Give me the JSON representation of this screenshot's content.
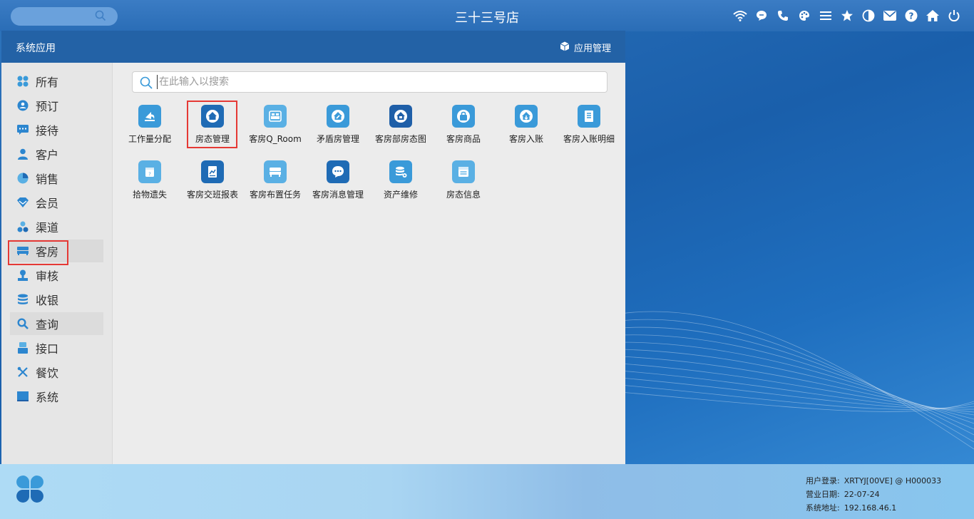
{
  "topbar": {
    "title": "三十三号店",
    "search_placeholder": "",
    "icons": [
      "wifi-icon",
      "chat-icon",
      "phone-icon",
      "palette-icon",
      "menu-icon",
      "star-icon",
      "theme-icon",
      "mail-icon",
      "help-icon",
      "home-icon",
      "power-icon"
    ]
  },
  "app": {
    "title": "系统应用",
    "manage_label": "应用管理",
    "search_placeholder": "在此输入以搜索",
    "sidebar": {
      "items": [
        {
          "label": "所有",
          "icon": "grid-icon"
        },
        {
          "label": "预订",
          "icon": "booking-icon"
        },
        {
          "label": "接待",
          "icon": "reception-icon"
        },
        {
          "label": "客户",
          "icon": "customer-icon"
        },
        {
          "label": "销售",
          "icon": "sales-icon"
        },
        {
          "label": "会员",
          "icon": "member-icon"
        },
        {
          "label": "渠道",
          "icon": "channel-icon"
        },
        {
          "label": "客房",
          "icon": "room-icon"
        },
        {
          "label": "审核",
          "icon": "audit-icon"
        },
        {
          "label": "收银",
          "icon": "cashier-icon"
        },
        {
          "label": "查询",
          "icon": "query-icon"
        },
        {
          "label": "接口",
          "icon": "interface-icon"
        },
        {
          "label": "餐饮",
          "icon": "dining-icon"
        },
        {
          "label": "系统",
          "icon": "system-icon"
        }
      ],
      "selected": "客房"
    },
    "tiles": [
      {
        "label": "工作量分配",
        "icon": "workload-icon",
        "color": "#3a9ad9"
      },
      {
        "label": "房态管理",
        "icon": "house-icon",
        "color": "#1f6bb5"
      },
      {
        "label": "客房Q_Room",
        "icon": "bed-icon",
        "color": "#5ab0e4"
      },
      {
        "label": "矛盾房管理",
        "icon": "conflict-room-icon",
        "color": "#3a9ad9"
      },
      {
        "label": "客房部房态图",
        "icon": "room-status-map-icon",
        "color": "#1f5fa8"
      },
      {
        "label": "客房商品",
        "icon": "bag-icon",
        "color": "#3a9ad9"
      },
      {
        "label": "客房入账",
        "icon": "room-posting-icon",
        "color": "#3a9ad9"
      },
      {
        "label": "客房入账明细",
        "icon": "posting-detail-icon",
        "color": "#3a9ad9"
      },
      {
        "label": "拾物遗失",
        "icon": "lost-found-icon",
        "color": "#5ab0e4"
      },
      {
        "label": "客房交班报表",
        "icon": "shift-report-icon",
        "color": "#1f6bb5"
      },
      {
        "label": "客房布置任务",
        "icon": "bed-task-icon",
        "color": "#5ab0e4"
      },
      {
        "label": "客房消息管理",
        "icon": "message-icon",
        "color": "#1f6bb5"
      },
      {
        "label": "资产维修",
        "icon": "asset-repair-icon",
        "color": "#3a9ad9"
      },
      {
        "label": "房态信息",
        "icon": "room-info-icon",
        "color": "#5ab0e4"
      }
    ]
  },
  "status": {
    "user_label": "用户登录:",
    "user_value": "XRTYJ[00VE] @ H000033",
    "date_label": "营业日期:",
    "date_value": "22-07-24",
    "addr_label": "系统地址:",
    "addr_value": "192.168.46.1"
  },
  "colors": {
    "accent": "#2362a6",
    "highlight_box": "#e53935"
  }
}
